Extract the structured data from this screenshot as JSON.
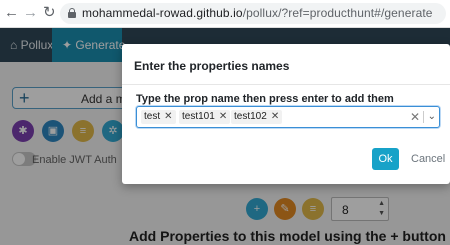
{
  "browser": {
    "url_host": "mohammedal-rowad.github.io",
    "url_path": "/pollux/?ref=producthunt#/generate",
    "icons": {
      "back": "back-arrow-icon",
      "forward": "forward-arrow-icon",
      "reload": "reload-icon",
      "lock": "lock-icon"
    }
  },
  "app": {
    "brand_tab": "Pollux",
    "generate_tab": "Generate",
    "add_model_label": "Add a model",
    "enable_jwt_label": "Enable JWT Auth",
    "property_count": "8",
    "bottom_heading": "Add Properties to this model using the + button",
    "colors": {
      "appbar": "#2f4858",
      "active_tab": "#1a8fb0",
      "accent": "#17a2c8"
    }
  },
  "modal": {
    "title": "Enter the properties names",
    "field_label": "Type the prop name then press enter to add them",
    "tags": [
      "test",
      "test101",
      "test102"
    ],
    "ok_label": "Ok",
    "cancel_label": "Cancel"
  }
}
